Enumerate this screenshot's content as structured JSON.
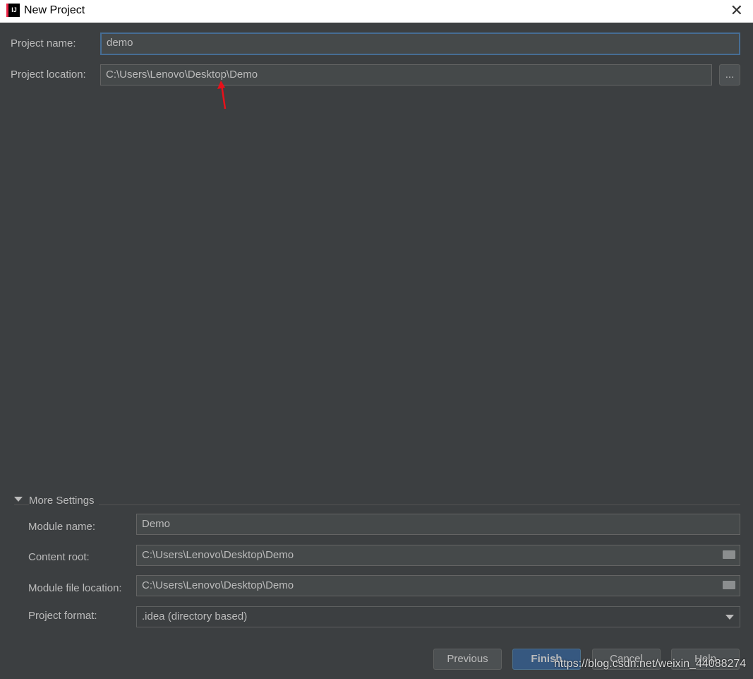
{
  "window": {
    "title": "New Project",
    "app_icon_text": "IJ",
    "close": "✕"
  },
  "project_name": {
    "label": "Project name:",
    "value": "demo"
  },
  "project_location": {
    "label": "Project location:",
    "value": "C:\\Users\\Lenovo\\Desktop\\Demo",
    "browse": "..."
  },
  "more_settings": {
    "label": "More Settings",
    "module_name": {
      "label": "Module name:",
      "value": "Demo"
    },
    "content_root": {
      "label": "Content root:",
      "value": "C:\\Users\\Lenovo\\Desktop\\Demo"
    },
    "module_file_location": {
      "label": "Module file location:",
      "value": "C:\\Users\\Lenovo\\Desktop\\Demo"
    },
    "project_format": {
      "label": "Project format:",
      "value": ".idea (directory based)"
    }
  },
  "buttons": {
    "previous": "Previous",
    "finish": "Finish",
    "cancel": "Cancel",
    "help": "Help"
  },
  "watermark": "https://blog.csdn.net/weixin_44088274",
  "annotation_color": "#e8101a"
}
